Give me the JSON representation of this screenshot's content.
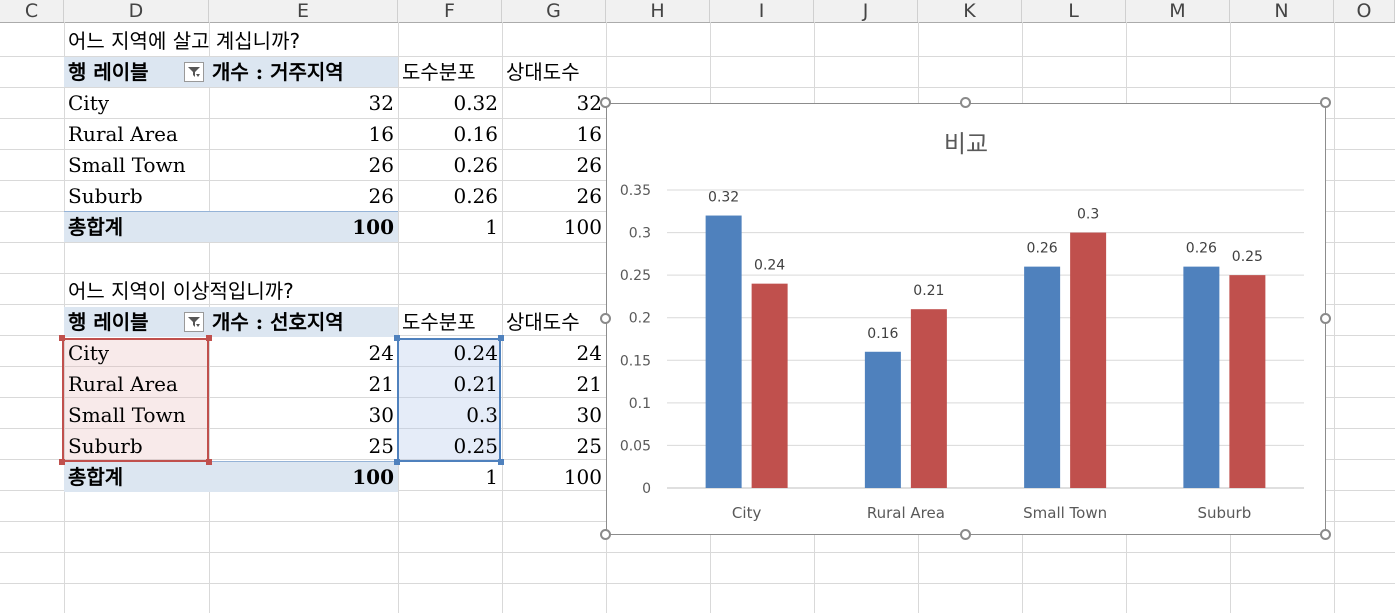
{
  "columns": [
    "C",
    "D",
    "E",
    "F",
    "G",
    "H",
    "I",
    "J",
    "K",
    "L",
    "M",
    "N",
    "O"
  ],
  "table1": {
    "question": "어느 지역에 살고 계십니까?",
    "row_label_header": "행 레이블",
    "count_header": "개수 : 거주지역",
    "freq_header": "도수분포",
    "rel_header": "상대도수",
    "rows": [
      {
        "label": "City",
        "count": "32",
        "freq": "0.32",
        "rel": "32"
      },
      {
        "label": "Rural Area",
        "count": "16",
        "freq": "0.16",
        "rel": "16"
      },
      {
        "label": "Small Town",
        "count": "26",
        "freq": "0.26",
        "rel": "26"
      },
      {
        "label": "Suburb",
        "count": "26",
        "freq": "0.26",
        "rel": "26"
      }
    ],
    "total": {
      "label": "총합계",
      "count": "100",
      "freq": "1",
      "rel": "100"
    }
  },
  "table2": {
    "question": "어느 지역이 이상적입니까?",
    "row_label_header": "행 레이블",
    "count_header": "개수 : 선호지역",
    "freq_header": "도수분포",
    "rel_header": "상대도수",
    "rows": [
      {
        "label": "City",
        "count": "24",
        "freq": "0.24",
        "rel": "24"
      },
      {
        "label": "Rural Area",
        "count": "21",
        "freq": "0.21",
        "rel": "21"
      },
      {
        "label": "Small Town",
        "count": "30",
        "freq": "0.3",
        "rel": "30"
      },
      {
        "label": "Suburb",
        "count": "25",
        "freq": "0.25",
        "rel": "25"
      }
    ],
    "total": {
      "label": "총합계",
      "count": "100",
      "freq": "1",
      "rel": "100"
    }
  },
  "colors": {
    "series1": "#4f81bd",
    "series2": "#c0504d",
    "header_band": "#dce6f1"
  },
  "chart_data": {
    "type": "bar",
    "title": "비교",
    "categories": [
      "City",
      "Rural Area",
      "Small Town",
      "Suburb"
    ],
    "series": [
      {
        "values": [
          0.32,
          0.16,
          0.26,
          0.26
        ],
        "labels": [
          "0.32",
          "0.16",
          "0.26",
          "0.26"
        ],
        "color": "#4f81bd"
      },
      {
        "values": [
          0.24,
          0.21,
          0.3,
          0.25
        ],
        "labels": [
          "0.24",
          "0.21",
          "0.3",
          "0.25"
        ],
        "color": "#c0504d"
      }
    ],
    "ylim": [
      0,
      0.35
    ],
    "yticks": [
      "0",
      "0.05",
      "0.1",
      "0.15",
      "0.2",
      "0.25",
      "0.3",
      "0.35"
    ],
    "ytick_values": [
      0,
      0.05,
      0.1,
      0.15,
      0.2,
      0.25,
      0.3,
      0.35
    ],
    "grid": true,
    "legend": "none"
  }
}
